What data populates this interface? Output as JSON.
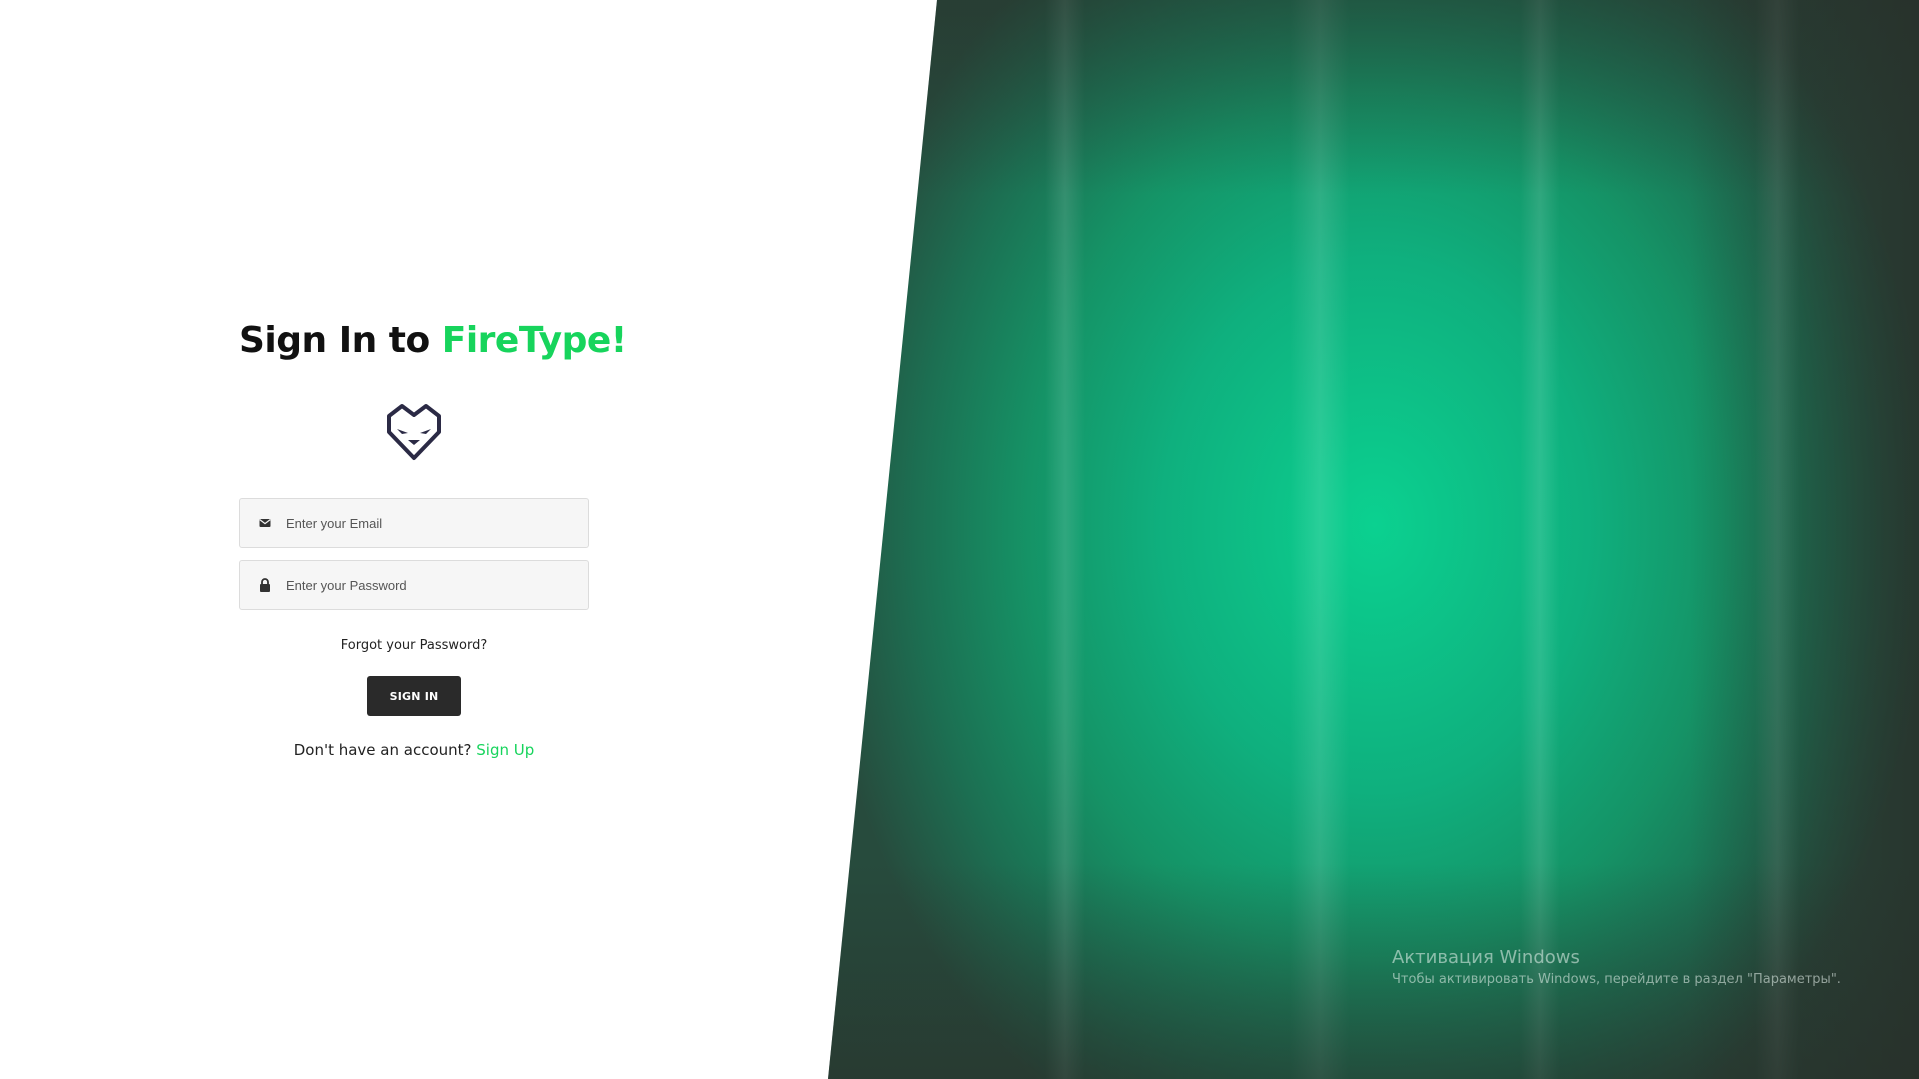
{
  "signin": {
    "heading_prefix": "Sign In to ",
    "heading_brand": "FireType!",
    "logo_icon": "fox-logo-icon",
    "email": {
      "icon": "envelope-icon",
      "placeholder": "Enter your Email",
      "value": ""
    },
    "password": {
      "icon": "lock-icon",
      "placeholder": "Enter your Password",
      "value": ""
    },
    "forgot_label": "Forgot your Password?",
    "submit_label": "SIGN IN",
    "no_account_text": "Don't have an account?",
    "signup_label": "Sign Up"
  },
  "watermark": {
    "title": "Активация Windows",
    "subtitle": "Чтобы активировать Windows, перейдите в раздел \"Параметры\"."
  },
  "colors": {
    "brand": "#17d45c",
    "button": "#2a2a2a",
    "panel_center": "#0bd190",
    "panel_edge": "#274b3d"
  }
}
